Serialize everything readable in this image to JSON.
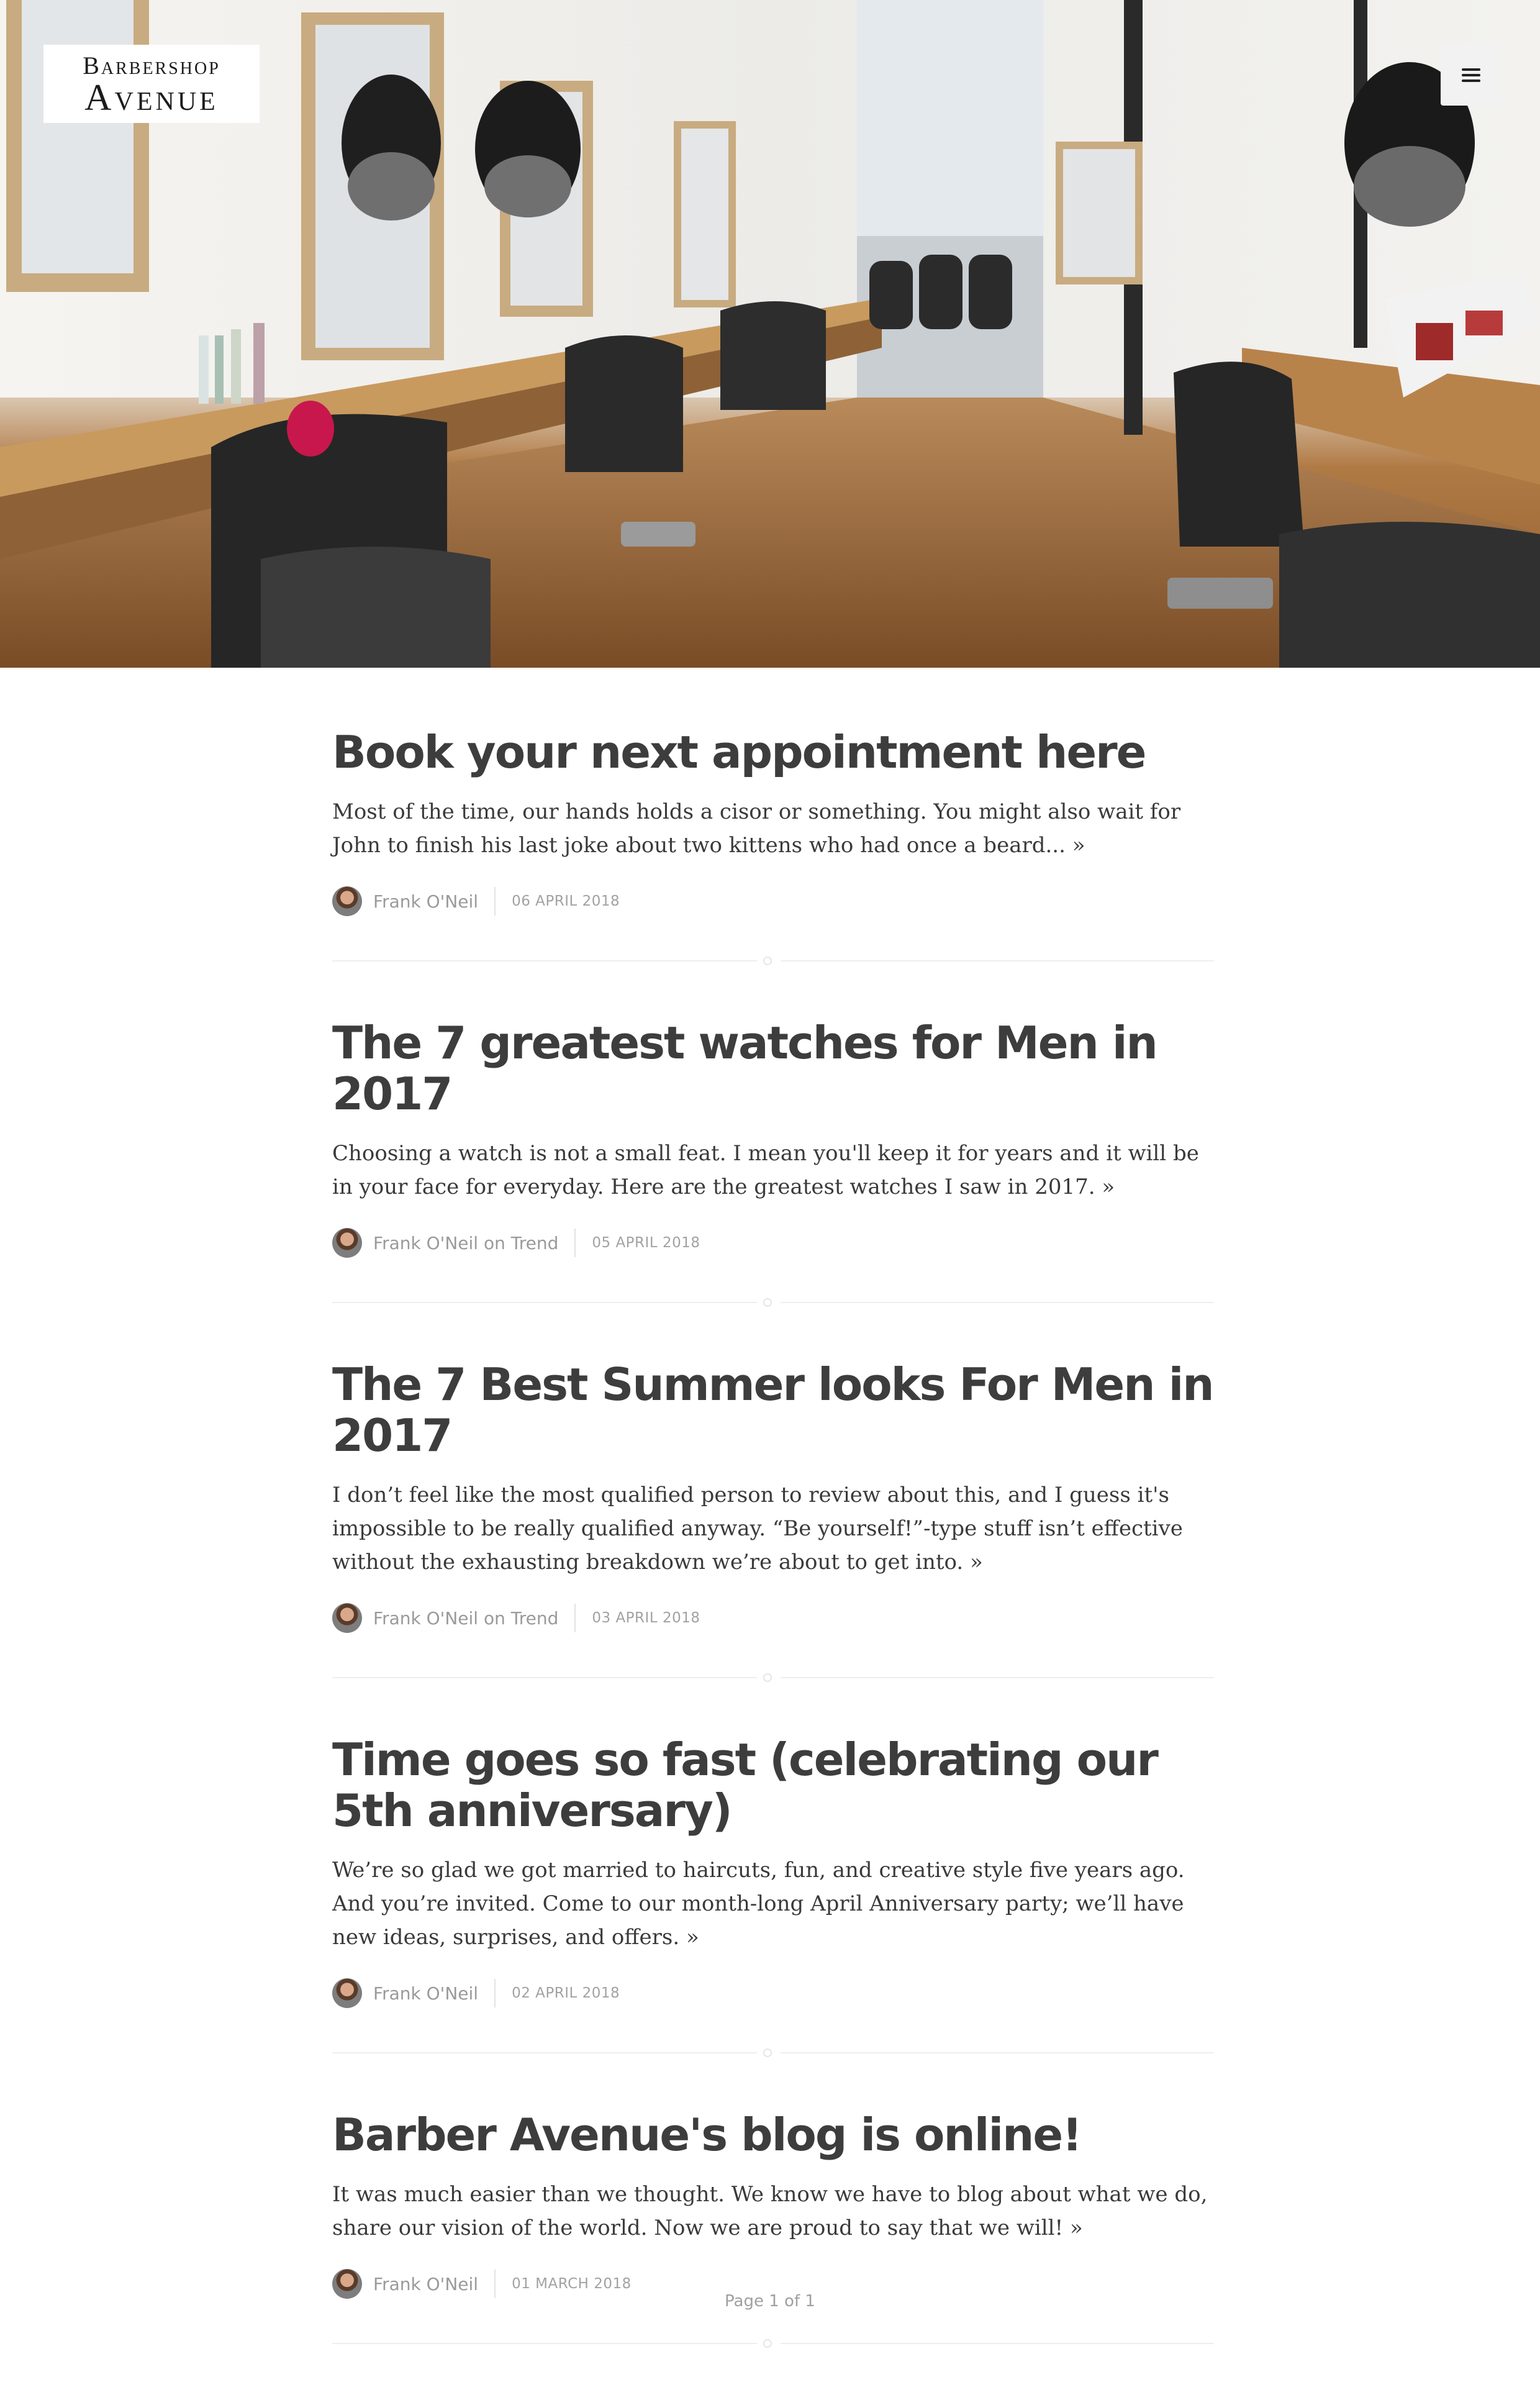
{
  "header": {
    "logo_line1": "Barbershop",
    "logo_line2": "Avenue",
    "menu_icon": "hamburger-menu-icon"
  },
  "hero": {
    "image": "barbershop-interior-photo"
  },
  "posts": [
    {
      "title": "Book your next appointment here",
      "excerpt": "Most of the time, our hands holds a cisor or something. You might also wait for John to finish his last joke about two kittens who had once a beard...",
      "more": "»",
      "author": "Frank O'Neil",
      "date": "06 April 2018"
    },
    {
      "title": "The 7 greatest watches for Men in 2017",
      "excerpt": "Choosing a watch is not a small feat. I mean you'll keep it for years and it will be in your face for everyday. Here are the greatest watches I saw in 2017.",
      "more": "»",
      "author": "Frank O'Neil on Trend",
      "date": "05 April 2018"
    },
    {
      "title": "The 7 Best Summer looks For Men in 2017",
      "excerpt": "I don’t feel like the most qualified person to review about this, and I guess it's impossible to be really qualified anyway. “Be yourself!”-type stuff isn’t effective without the exhausting breakdown we’re about to get into.",
      "more": "»",
      "author": "Frank O'Neil on Trend",
      "date": "03 April 2018"
    },
    {
      "title": "Time goes so fast (celebrating our 5th anniversary)",
      "excerpt": "We’re so glad we got married to haircuts, fun, and creative style five years ago. And you’re invited. Come to our month-long April Anniversary party; we’ll have new ideas, surprises, and offers.",
      "more": "»",
      "author": "Frank O'Neil",
      "date": "02 April 2018"
    },
    {
      "title": "Barber Avenue's blog is online!",
      "excerpt": "It was much easier than we thought. We know we have to blog about what we do, share our vision of the world. Now we are proud to say that we will!",
      "more": "»",
      "author": "Frank O'Neil",
      "date": "01 March 2018"
    }
  ],
  "pagination": {
    "label": "Page 1 of 1"
  }
}
